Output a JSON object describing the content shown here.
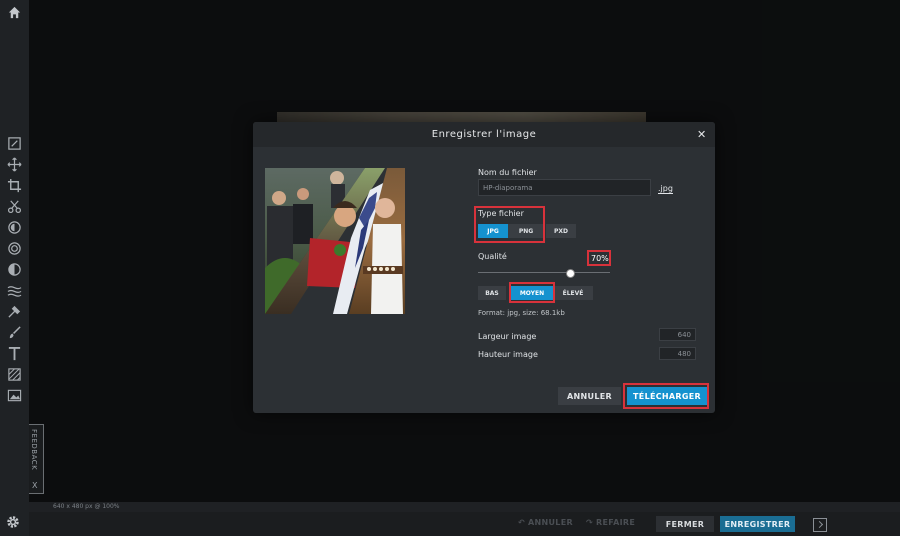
{
  "sidebar": {
    "icons": [
      "home-icon",
      "edit-icon",
      "move-icon",
      "crop-icon",
      "cut-icon",
      "adjust-icon",
      "effects-icon",
      "filter-icon",
      "liquify-icon",
      "stamp-icon",
      "brush-icon",
      "text-icon",
      "pattern-icon",
      "image-icon"
    ]
  },
  "feedback": {
    "label": "FEEDBACK",
    "close": "X"
  },
  "footer": {
    "info": "640 x 480 px @ 100%",
    "undo": "ANNULER",
    "redo": "REFAIRE",
    "close_label": "FERMER",
    "save_label": "ENREGISTRER"
  },
  "modal": {
    "title": "Enregistrer l'image",
    "close": "✕",
    "filename_label": "Nom du fichier",
    "filename_value": "HP-diaporama",
    "extension": ".jpg",
    "filetype_label": "Type fichier",
    "filetypes": [
      "JPG",
      "PNG",
      "PXD"
    ],
    "filetype_selected": "JPG",
    "quality_label": "Qualité",
    "quality_value": "70%",
    "quality_fraction": 0.7,
    "quality_presets": [
      "BAS",
      "MOYEN",
      "ÉLEVÉ"
    ],
    "quality_preset_selected": "MOYEN",
    "format_text": "Format: jpg, size: 68.1kb",
    "width_label": "Largeur image",
    "width_value": "640",
    "height_label": "Hauteur image",
    "height_value": "480",
    "cancel_label": "ANNULER",
    "download_label": "TÉLÉCHARGER"
  },
  "colors": {
    "accent": "#1592cf",
    "highlight": "#d8323b",
    "modal_bg": "#2c3034"
  }
}
